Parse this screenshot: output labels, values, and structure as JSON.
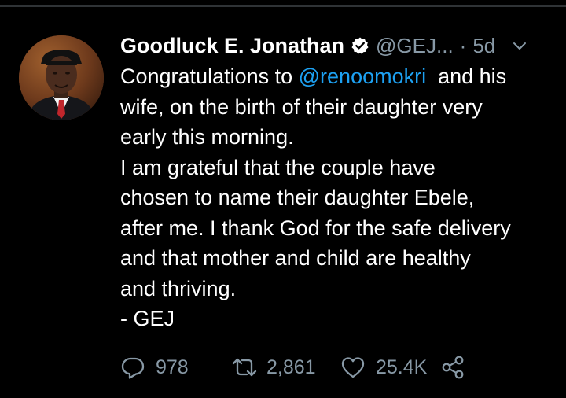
{
  "tweet": {
    "author_name": "Goodluck E. Jonathan",
    "handle": "@GEJ...",
    "separator": "·",
    "time": "5d",
    "verified": true,
    "text_lines": [
      {
        "before": "Congratulations to ",
        "mention": "@renoomokri",
        "after": "  and his"
      },
      {
        "text": "wife, on the birth of their daughter very"
      },
      {
        "text": "early this morning."
      },
      {
        "text": "I am grateful that the couple have"
      },
      {
        "text": "chosen to name their daughter Ebele,"
      },
      {
        "text": "after me. I thank God for the safe delivery"
      },
      {
        "text": "and that mother and child are healthy"
      },
      {
        "text": "and thriving."
      },
      {
        "text": "- GEJ"
      }
    ]
  },
  "actions": {
    "replies": "978",
    "retweets": "2,861",
    "likes": "25.4K"
  },
  "icons": {
    "verified": "verified-badge-icon",
    "menu": "chevron-down-icon",
    "reply": "reply-bubble-icon",
    "retweet": "retweet-icon",
    "like": "heart-icon",
    "share": "share-icon"
  },
  "colors": {
    "background": "#000000",
    "text": "#ffffff",
    "muted": "#8899a6",
    "accent": "#1da1f2",
    "divider": "#2f3336"
  }
}
